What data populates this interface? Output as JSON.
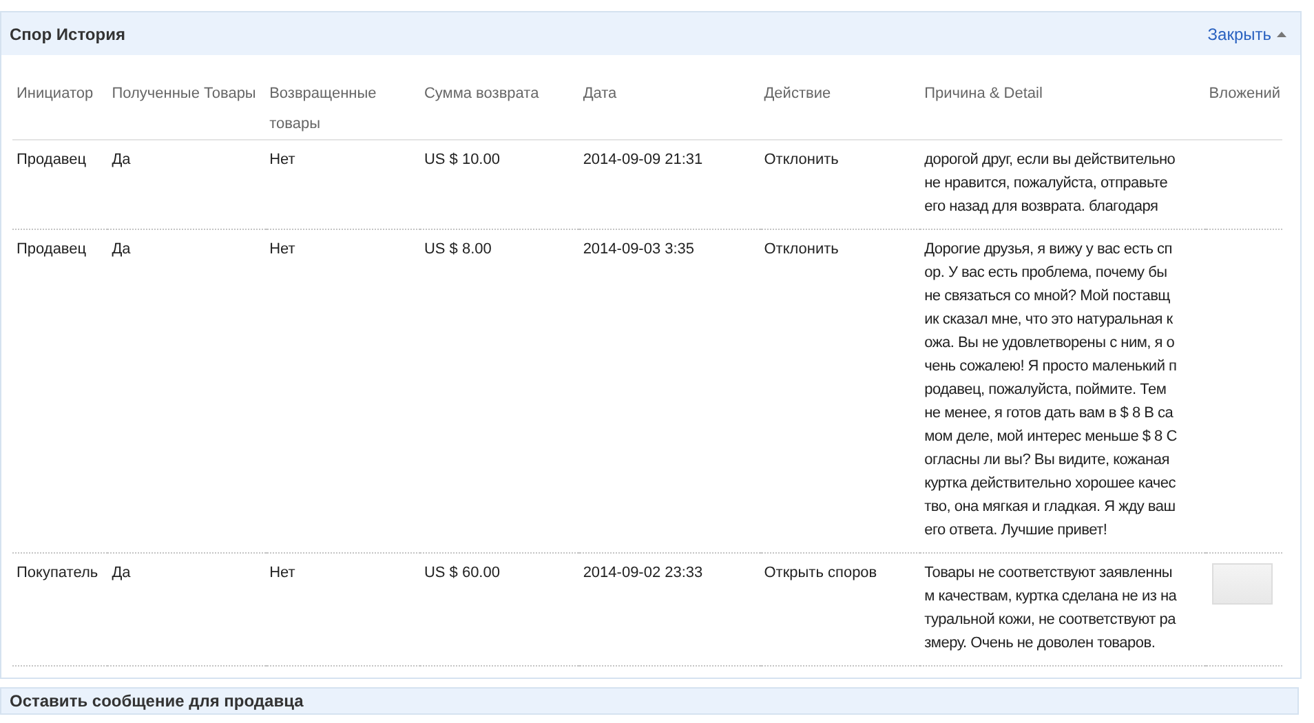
{
  "panel": {
    "title": "Спор История",
    "close_link": "Закрыть"
  },
  "table": {
    "columns": [
      "Инициатор",
      "Полученные Товары",
      "Возвращенные товары",
      "Сумма возврата",
      "Дата",
      "Действие",
      "Причина & Detail",
      "Вложений"
    ],
    "rows": [
      {
        "initiator": "Продавец",
        "goods_received": "Да",
        "goods_returned": "Нет",
        "refund_amount": "US $ 10.00",
        "date": "2014-09-09 21:31",
        "action": "Отклонить",
        "reason": "дорогой друг, если вы действительно не нравится, пожалуйста, отправьте его назад для возврата. благодаря",
        "attachment": false
      },
      {
        "initiator": "Продавец",
        "goods_received": "Да",
        "goods_returned": "Нет",
        "refund_amount": "US $ 8.00",
        "date": "2014-09-03 3:35",
        "action": "Отклонить",
        "reason": "Дорогие друзья, я вижу у вас есть спор. У вас есть проблема, почему бы не связаться со мной? Мой поставщик сказал мне, что это натуральная кожа. Вы не удовлетворены с ним, я очень сожалею! Я просто маленький продавец, пожалуйста, поймите. Тем не менее, я готов дать вам в $ 8 В самом деле, мой интерес меньше $ 8 Согласны ли вы? Вы видите, кожаная куртка действительно хорошее качество, она мягкая и гладкая. Я жду вашего ответа. Лучшие привет!",
        "attachment": false
      },
      {
        "initiator": "Покупатель",
        "goods_received": "Да",
        "goods_returned": "Нет",
        "refund_amount": "US $ 60.00",
        "date": "2014-09-02 23:33",
        "action": "Открыть споров",
        "reason": "Товары не соответствуют заявленным качествам, куртка сделана не из натуральной кожи, не соответствуют размеру. Очень не доволен товаров.",
        "attachment": true
      }
    ]
  },
  "next_panel": {
    "title": "Оставить сообщение для продавца"
  }
}
